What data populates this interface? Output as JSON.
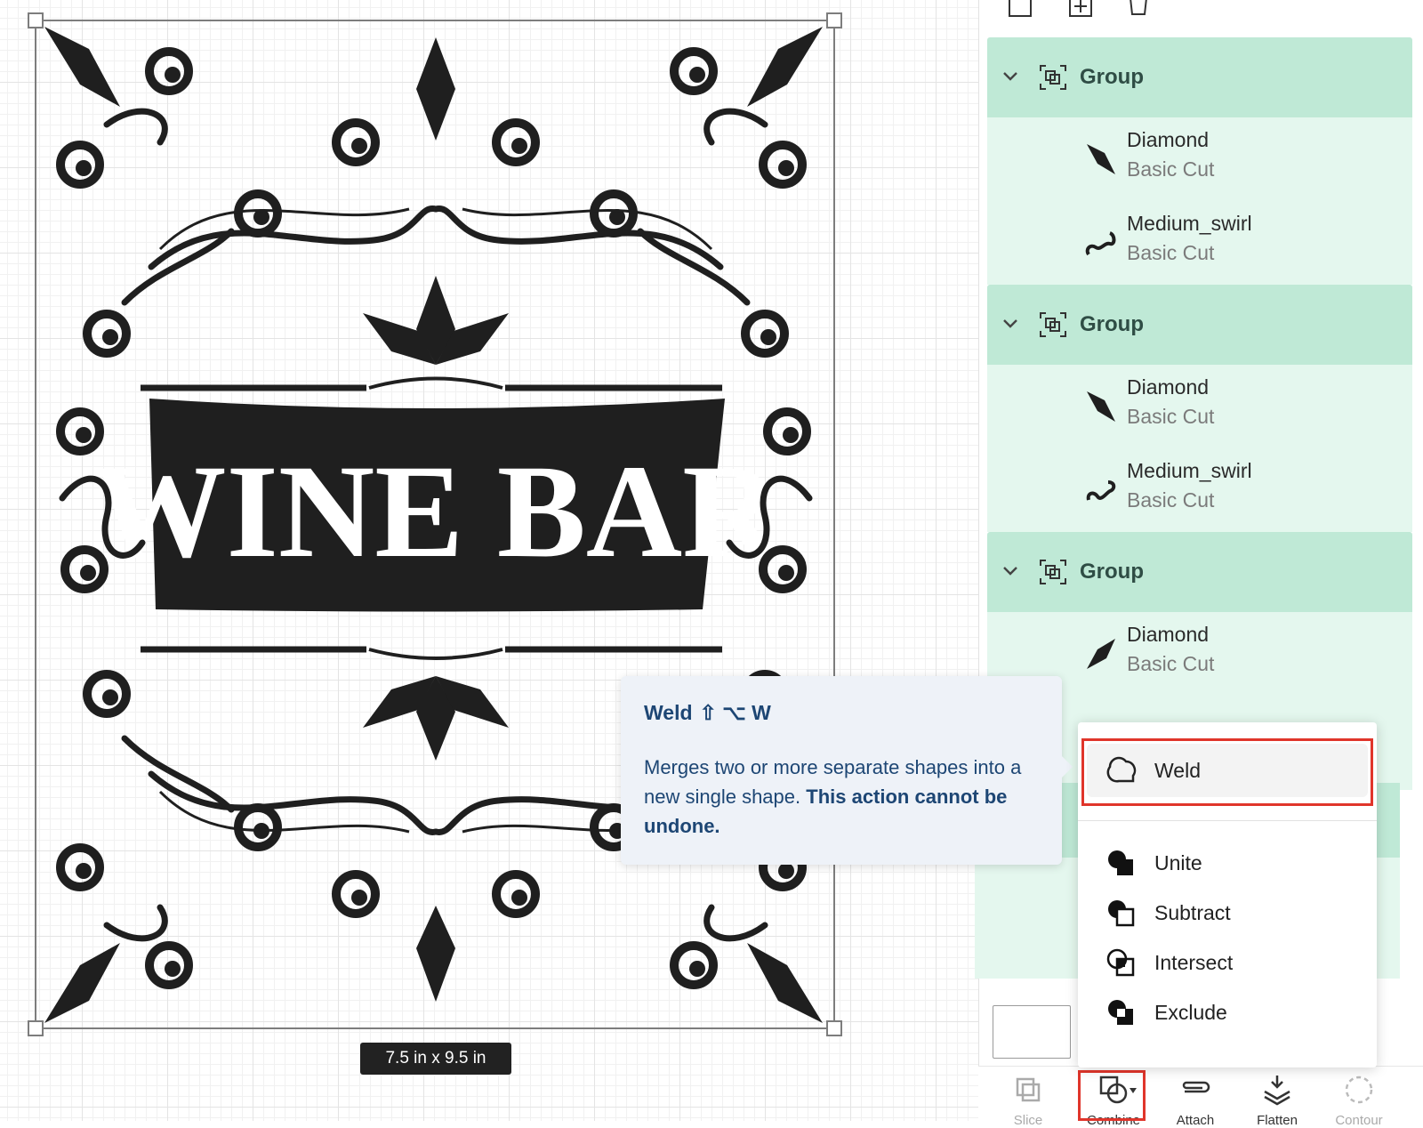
{
  "canvas": {
    "size_label": "7.5  in x 9.5  in",
    "design_text": "WINE BAR"
  },
  "layers": {
    "groups": [
      {
        "title": "Group",
        "items": [
          {
            "name": "Diamond",
            "type": "Basic Cut",
            "icon": "diamond-icon"
          },
          {
            "name": "Medium_swirl",
            "type": "Basic Cut",
            "icon": "swirl-icon"
          }
        ]
      },
      {
        "title": "Group",
        "items": [
          {
            "name": "Diamond",
            "type": "Basic Cut",
            "icon": "diamond-icon"
          },
          {
            "name": "Medium_swirl",
            "type": "Basic Cut",
            "icon": "swirl-icon"
          }
        ]
      },
      {
        "title": "Group",
        "items": [
          {
            "name": "Diamond",
            "type": "Basic Cut",
            "icon": "diamond-icon"
          }
        ]
      }
    ]
  },
  "tooltip": {
    "title": "Weld",
    "shortcut": "⇧ ⌥ W",
    "description": "Merges two or more separate shapes into a new single shape.",
    "warning": "This action cannot be undone."
  },
  "combine_menu": {
    "items": [
      {
        "label": "Weld",
        "icon": "weld-icon"
      },
      {
        "label": "Unite",
        "icon": "unite-icon"
      },
      {
        "label": "Subtract",
        "icon": "subtract-icon"
      },
      {
        "label": "Intersect",
        "icon": "intersect-icon"
      },
      {
        "label": "Exclude",
        "icon": "exclude-icon"
      }
    ]
  },
  "bottom_toolbar": {
    "items": [
      {
        "label": "Slice",
        "icon": "slice-icon"
      },
      {
        "label": "Combine",
        "icon": "combine-icon"
      },
      {
        "label": "Attach",
        "icon": "attach-icon"
      },
      {
        "label": "Flatten",
        "icon": "flatten-icon"
      },
      {
        "label": "Contour",
        "icon": "contour-icon"
      }
    ]
  },
  "colors": {
    "group_header": "#bfe9d6",
    "group_body": "#e4f7ee",
    "tooltip_bg": "#eef2f8",
    "tooltip_text": "#1d4674",
    "highlight": "#e0352b"
  }
}
